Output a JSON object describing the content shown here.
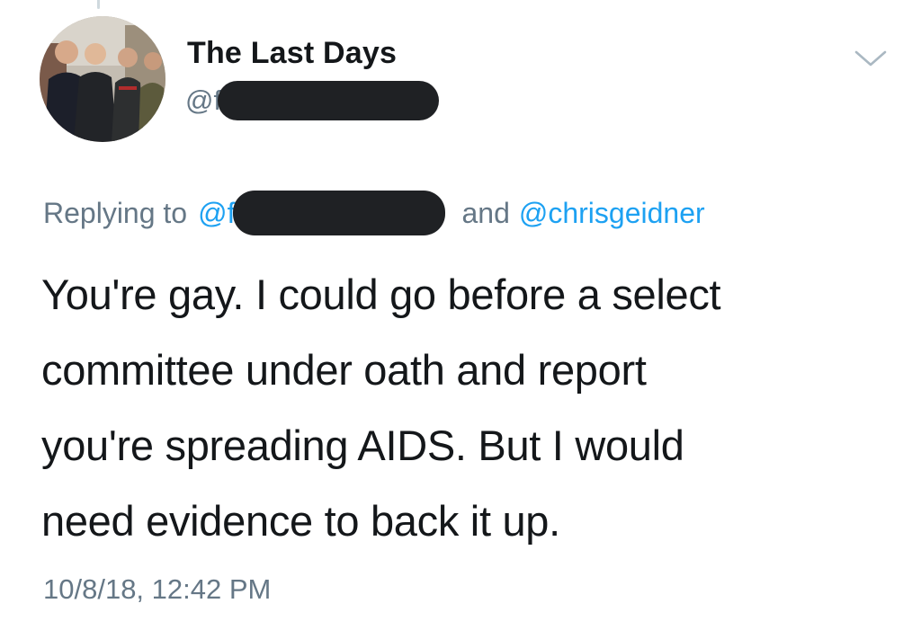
{
  "author": {
    "display_name": "The Last Days",
    "handle_visible": "@f"
  },
  "reply": {
    "prefix": "Replying to",
    "first_mention_visible": "@f",
    "conjunction": "and",
    "second_mention": "@chrisgeidner"
  },
  "tweet": {
    "lines": [
      "You're gay.  I could go before a select",
      "committee under oath and report",
      "you're spreading AIDS.  But I would",
      "need evidence to back it up."
    ],
    "timestamp": "10/8/18, 12:42 PM"
  },
  "icons": {
    "menu": "chevron-down-icon"
  },
  "colors": {
    "text_primary": "#14171a",
    "text_secondary": "#657786",
    "link": "#1da1f2",
    "redaction": "#1f2124",
    "background": "#ffffff"
  }
}
